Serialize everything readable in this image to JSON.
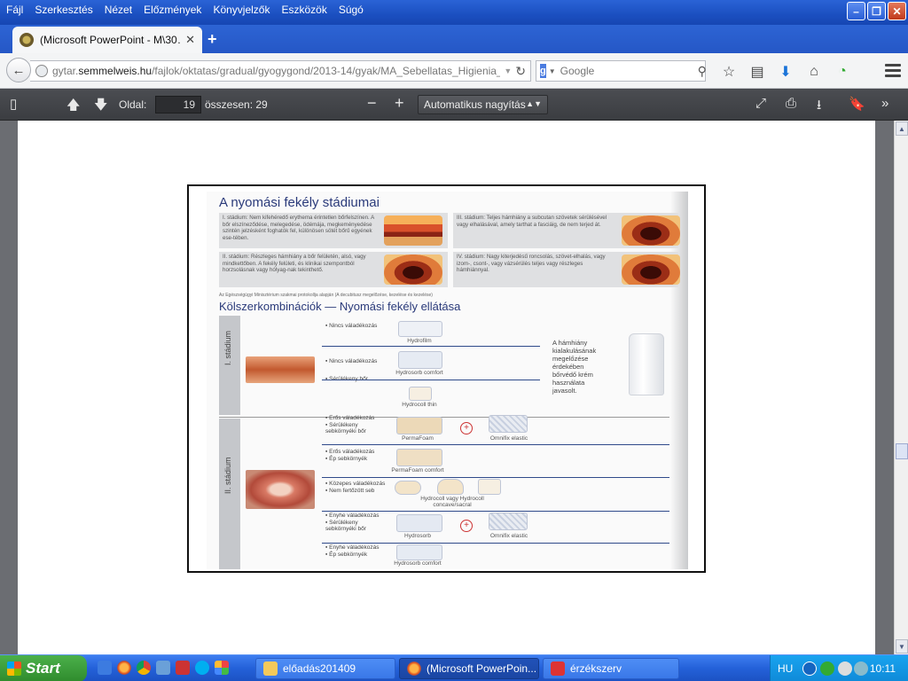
{
  "menu": [
    "Fájl",
    "Szerkesztés",
    "Nézet",
    "Előzmények",
    "Könyvjelzők",
    "Eszközök",
    "Súgó"
  ],
  "window_buttons": {
    "minimize": "–",
    "restore": "❐",
    "close": "✕"
  },
  "tab": {
    "title": "(Microsoft PowerPoint - M\\30…",
    "close": "✕",
    "new_tab": "+"
  },
  "nav": {
    "back": "←",
    "url_prefix": "gytar.",
    "url_domain": "semmelweis.hu",
    "url_path": "/fajlok/oktatas/gradual/gyogygond/2013-14/gyak/MA_Sebellatas_Higienia_gond_c",
    "search_engine": "g",
    "search_placeholder": "Google",
    "icons": [
      "star-icon",
      "reading-list-icon",
      "download-icon",
      "home-icon",
      "extension-icon"
    ]
  },
  "pdf_toolbar": {
    "page_label": "Oldal:",
    "page_number": "19",
    "total_label": "összesen: 29",
    "zoom_label": "Automatikus nagyítás",
    "zoom_out": "−",
    "zoom_in": "+"
  },
  "slide": {
    "title": "A nyomási fekély stádiumai",
    "stage1_text": "I. stádium: Nem kifehéredő erythema érintetlen bőrfelszínen. A bőr elszíneződése, melegedése, ödémája, megkeményedése szintén jelzésként foghatók fel, különösen sötét bőrű egyének ese-tében.",
    "stage3_text": "III. stádium: Teljes hámhiány a subcutan szövetek sérülésével vagy elhalásával, amely tarthat a fasciáig, de nem terjed át.",
    "stage2_text": "II. stádium: Részleges hámhiány a bőr felületén, alsó, vagy mindkettőben. A fekély felületi, és klinikai szempontból horzsolásnak vagy hólyag-nak tekinthető.",
    "stage4_text": "IV. stádium: Nagy kiterjedésű roncsolás, szövet-elhalás, vagy izom-, csont-, vagy vázsérülés teljes vagy részleges hámhiánnyal.",
    "caption": "Az Egészségügyi Minisztérium szakmai protokollja alapján (A decubitusz megelőzése, kezelése és kezelése)",
    "title2": "Kölszerkombinációk — Nyomási fekély ellátása",
    "stage_I": "I. stádium",
    "stage_II": "II. stádium",
    "note": "A hámhiány kialakulásának megelőzése érdekében bőrvédő krém használata javasolt.",
    "rows_I": [
      {
        "bullets": [
          "Nincs váladékozás"
        ],
        "product": "Hydrofilm"
      },
      {
        "bullets": [
          "Nincs váladékozás",
          "Sérülékeny bőr"
        ],
        "product": "Hydrosorb comfort"
      },
      {
        "bullets": [],
        "product": "Hydrocoll thin"
      }
    ],
    "rows_II": [
      {
        "bullets": [
          "Erős váladékozás",
          "Sérülékeny sebkörnyéki bőr"
        ],
        "product": "PermaFoam",
        "product2": "Omnifix elastic"
      },
      {
        "bullets": [
          "Erős váladékozás",
          "Ép sebkörnyék"
        ],
        "product": "PermaFoam comfort"
      },
      {
        "bullets": [
          "Közepes váladékozás",
          "Nem fertőzött seb"
        ],
        "product": "Hydrocoll vagy Hydrocoll concave/sacral"
      },
      {
        "bullets": [
          "Enyhe váladékozás",
          "Sérülékeny sebkörnyéki bőr"
        ],
        "product": "Hydrosorb",
        "product2": "Omnifix elastic"
      },
      {
        "bullets": [
          "Enyhe váladékozás",
          "Ép sebkörnyék"
        ],
        "product": "Hydrosorb comfort"
      }
    ]
  },
  "taskbar": {
    "start": "Start",
    "tasks": [
      "előadás201409",
      "(Microsoft PowerPoin...",
      "érzékszerv"
    ],
    "lang": "HU",
    "clock": "10:11"
  }
}
